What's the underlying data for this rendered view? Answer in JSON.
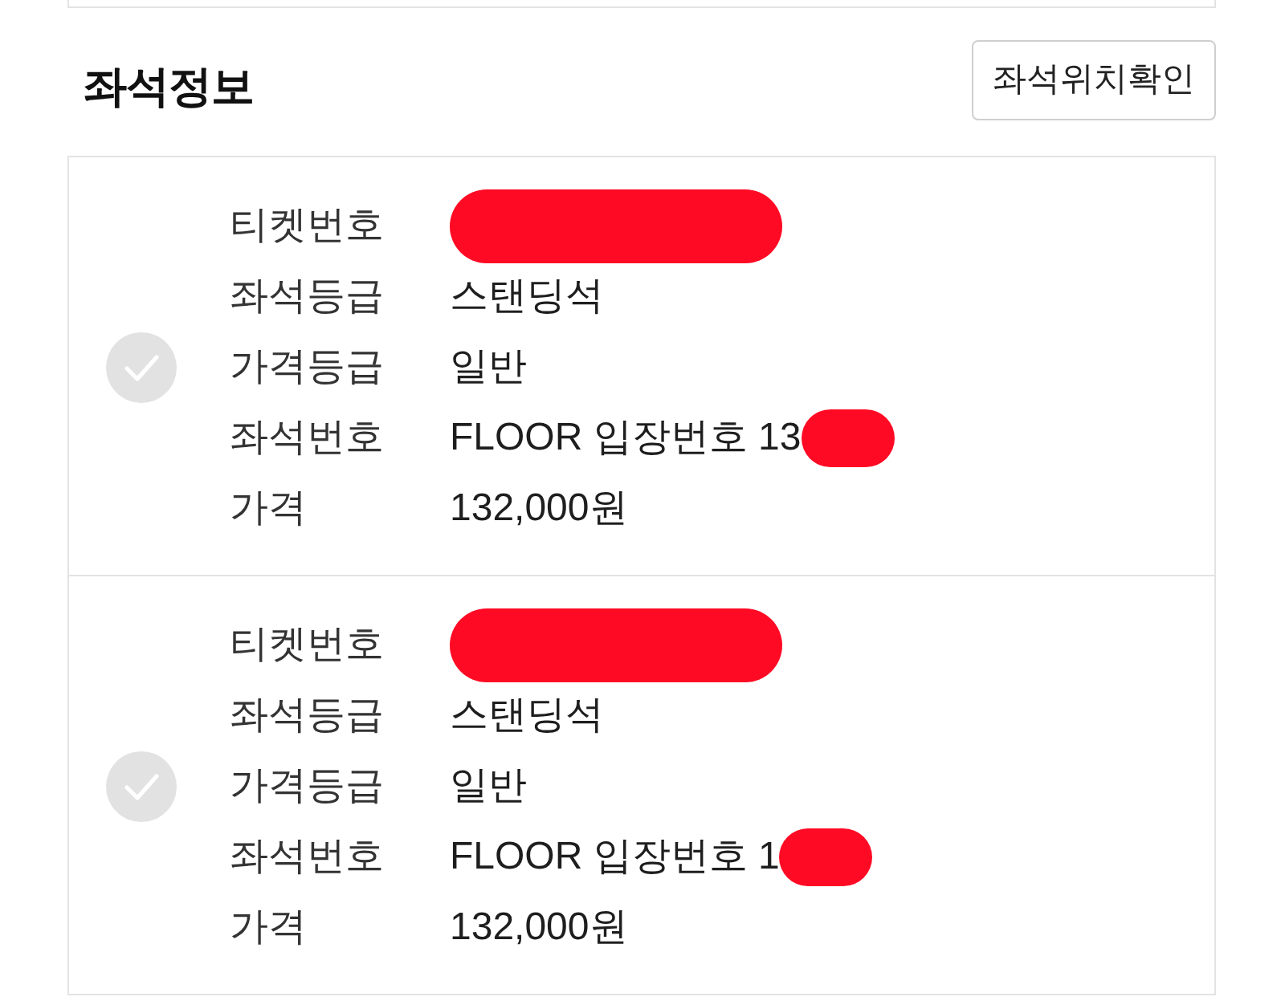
{
  "section": {
    "title": "좌석정보",
    "button": "좌석위치확인"
  },
  "tickets": [
    {
      "selected": false,
      "fields": [
        {
          "label": "티켓번호",
          "redacted": true
        },
        {
          "label": "좌석등급",
          "value": "스탠딩석"
        },
        {
          "label": "가격등급",
          "value": "일반"
        },
        {
          "label": "좌석번호",
          "value": "FLOOR 입장번호 13",
          "redacted": true
        },
        {
          "label": "가격",
          "value": "132,000원"
        }
      ]
    },
    {
      "selected": false,
      "fields": [
        {
          "label": "티켓번호",
          "redacted": true
        },
        {
          "label": "좌석등급",
          "value": "스탠딩석"
        },
        {
          "label": "가격등급",
          "value": "일반"
        },
        {
          "label": "좌석번호",
          "value": "FLOOR 입장번호 1",
          "redacted": true
        },
        {
          "label": "가격",
          "value": "132,000원"
        }
      ]
    }
  ]
}
